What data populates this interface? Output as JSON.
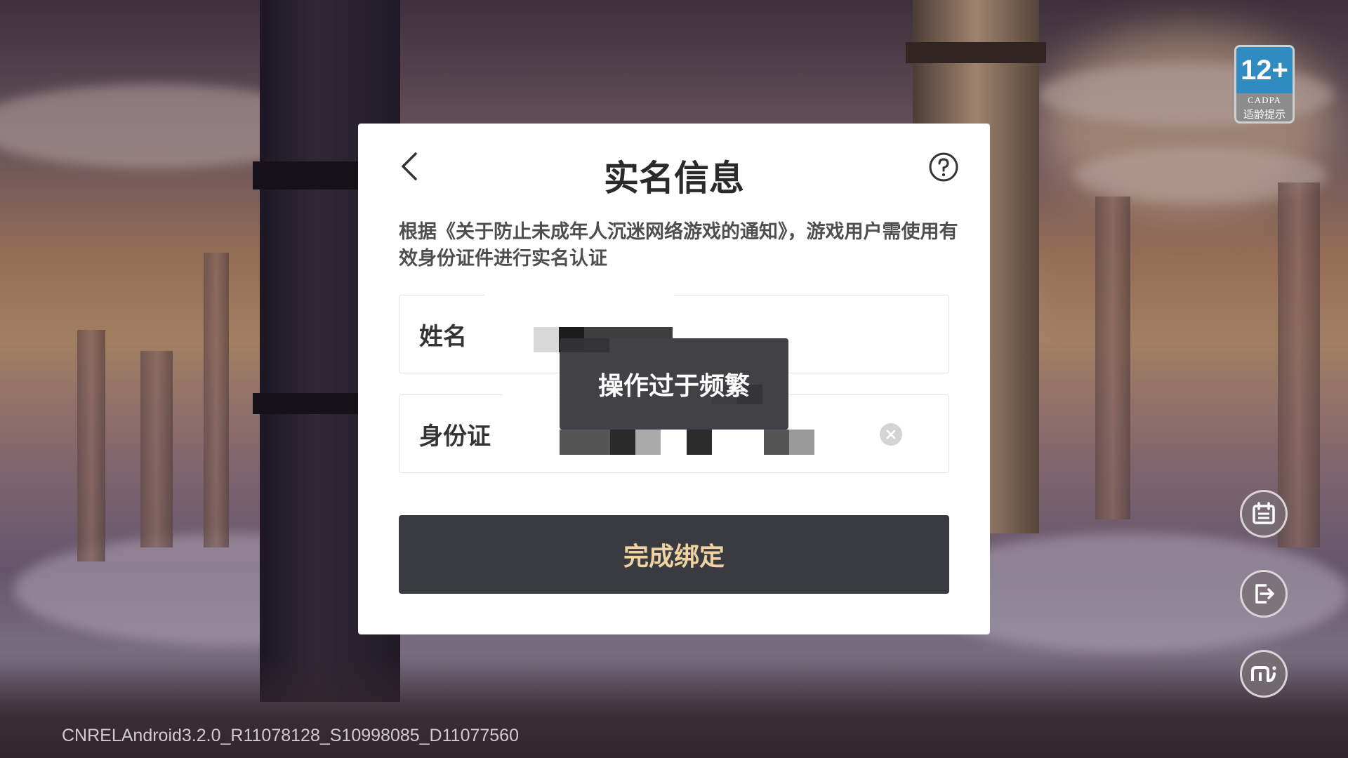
{
  "dialog": {
    "title": "实名信息",
    "notice": "根据《关于防止未成年人沉迷网络游戏的通知》，游戏用户需使用有效身份证件进行实名认证",
    "name_field": {
      "label": "姓名",
      "value": ""
    },
    "id_field": {
      "label": "身份证",
      "value": ""
    },
    "submit_label": "完成绑定"
  },
  "toast": {
    "message": "操作过于频繁"
  },
  "age_badge": {
    "rating": "12+",
    "org": "CADPA",
    "tip": "适龄提示"
  },
  "side_buttons": [
    {
      "icon": "calendar-icon"
    },
    {
      "icon": "logout-icon"
    },
    {
      "icon": "mi-logo-icon"
    }
  ],
  "footer": {
    "version": "CNRELAndroid3.2.0_R11078128_S10998085_D11077560"
  },
  "colors": {
    "dialog_bg": "#ffffff",
    "button_bg": "#393b41",
    "button_text": "#f1d3a2",
    "toast_bg": "#343438"
  }
}
